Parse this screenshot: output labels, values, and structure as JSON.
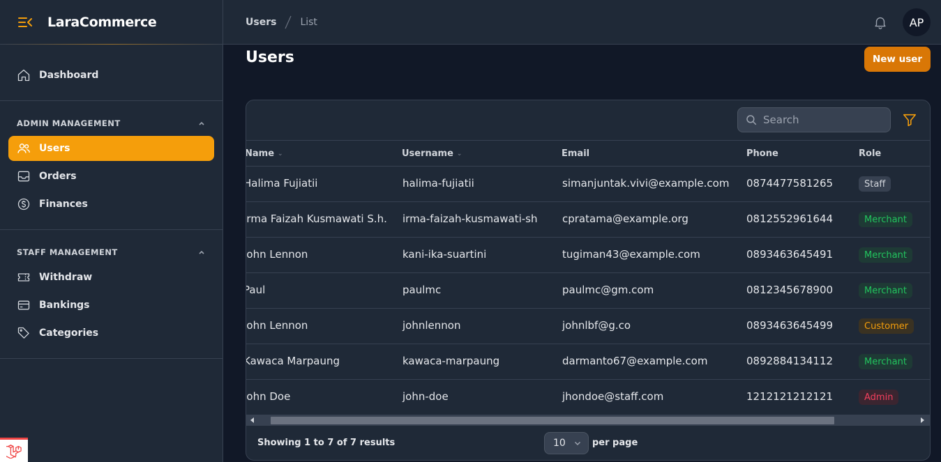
{
  "app": {
    "title": "LaraCommerce"
  },
  "colors": {
    "accent": "#f59e0b",
    "button": "#d97706",
    "bg": "#111827",
    "panel": "#1f2937"
  },
  "sidebar": {
    "dashboard": {
      "label": "Dashboard",
      "icon": "home-icon"
    },
    "groups": [
      {
        "label": "ADMIN MANAGEMENT",
        "items": [
          {
            "label": "Users",
            "icon": "users-icon",
            "active": true
          },
          {
            "label": "Orders",
            "icon": "inbox-icon"
          },
          {
            "label": "Finances",
            "icon": "dollar-icon"
          }
        ]
      },
      {
        "label": "STAFF MANAGEMENT",
        "items": [
          {
            "label": "Withdraw",
            "icon": "ticket-icon"
          },
          {
            "label": "Bankings",
            "icon": "credit-card-icon"
          },
          {
            "label": "Categories",
            "icon": "tag-icon"
          }
        ]
      }
    ]
  },
  "topbar": {
    "breadcrumbs": [
      "Users",
      "List"
    ],
    "avatar_initials": "AP"
  },
  "page": {
    "title": "Users",
    "new_button": "New user"
  },
  "table": {
    "search_placeholder": "Search",
    "columns": [
      "Name",
      "Username",
      "Email",
      "Phone",
      "Role"
    ],
    "rows": [
      {
        "name": "Halima Fujiatii",
        "username": "halima-fujiatii",
        "email": "simanjuntak.vivi@example.com",
        "phone": "0874477581265",
        "role": "Staff"
      },
      {
        "name": "Irma Faizah Kusmawati S.h.",
        "username": "irma-faizah-kusmawati-sh",
        "email": "cpratama@example.org",
        "phone": "0812552961644",
        "role": "Merchant"
      },
      {
        "name": "John Lennon",
        "username": "kani-ika-suartini",
        "email": "tugiman43@example.com",
        "phone": "0893463645491",
        "role": "Merchant"
      },
      {
        "name": "Paul",
        "username": "paulmc",
        "email": "paulmc@gm.com",
        "phone": "0812345678900",
        "role": "Merchant"
      },
      {
        "name": "John Lennon",
        "username": "johnlennon",
        "email": "johnlbf@g.co",
        "phone": "0893463645499",
        "role": "Customer"
      },
      {
        "name": "Kawaca Marpaung",
        "username": "kawaca-marpaung",
        "email": "darmanto67@example.com",
        "phone": "0892884134112",
        "role": "Merchant"
      },
      {
        "name": "John Doe",
        "username": "john-doe",
        "email": "jhondoe@staff.com",
        "phone": "1212121212121",
        "role": "Admin"
      }
    ],
    "role_colors": {
      "Staff": {
        "fg": "#d1d5db",
        "bg": "#374151"
      },
      "Merchant": {
        "fg": "#22c55e",
        "bg": "#1e3a35"
      },
      "Customer": {
        "fg": "#f59e0b",
        "bg": "#3a3222"
      },
      "Admin": {
        "fg": "#f43f5e",
        "bg": "#3b2530"
      }
    }
  },
  "footer": {
    "showing": "Showing 1 to 7 of 7 results",
    "per_page_value": "10",
    "per_page_label": "per page"
  }
}
